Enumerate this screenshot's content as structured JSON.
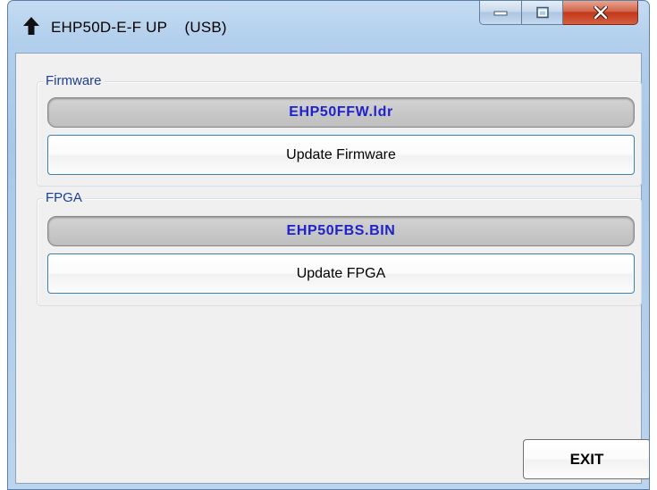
{
  "window": {
    "title": "EHP50D-E-F UP    (USB)",
    "icon": "up-arrow-icon",
    "controls": {
      "minimize_icon": "minimize-icon",
      "maximize_icon": "maximize-icon",
      "close_icon": "close-icon"
    }
  },
  "firmware": {
    "group_label": "Firmware",
    "file_name": "EHP50FFW.ldr",
    "button_label": "Update Firmware"
  },
  "fpga": {
    "group_label": "FPGA",
    "file_name": "EHP50FBS.BIN",
    "button_label": "Update FPGA"
  },
  "footer": {
    "exit_label": "EXIT"
  },
  "colors": {
    "group_label": "#1c3f95",
    "file_name_text": "#1d23c9",
    "close_button": "#c2391a"
  }
}
